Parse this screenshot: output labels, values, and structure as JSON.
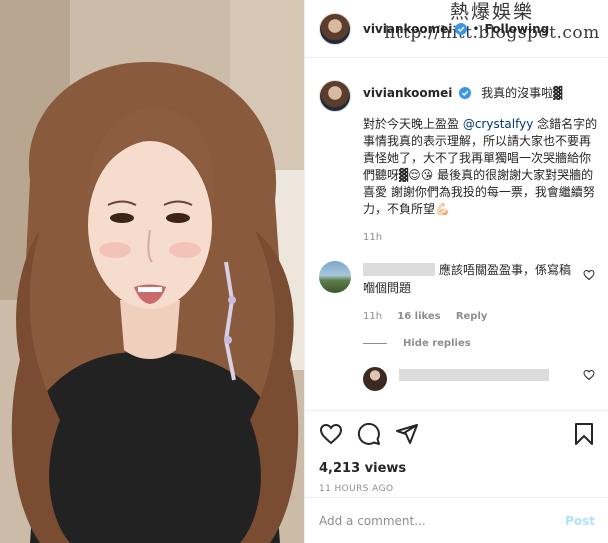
{
  "watermark": {
    "line1": "熱爆娛樂",
    "line2": "http://hitt.blogspot.com"
  },
  "header": {
    "username": "viviankoomei",
    "separator": "•",
    "follow_label": "Following"
  },
  "caption": {
    "username": "viviankoomei",
    "title": "我真的沒事啦▓",
    "text_before": "對於今天晚上盈盈 ",
    "mention": "@crystalfyy",
    "text_after": " 念錯名字的事情我真的表示理解，所以請大家也不要再責怪她了，大不了我再單獨唱一次哭牆給你們聽呀▓😌😘 最後真的很謝謝大家對哭牆的喜愛 謝謝你們為我投的每一票，我會繼續努力，不負所望💪🏻",
    "time": "11h"
  },
  "comment": {
    "text": "應該唔關盈盈事，係寫稿嗰個問題",
    "time": "11h",
    "likes": "16 likes",
    "reply_label": "Reply"
  },
  "hide_replies": "Hide replies",
  "stats": {
    "views": "4,213 views",
    "time_ago": "11 HOURS AGO"
  },
  "add_comment": {
    "placeholder": "Add a comment...",
    "post_label": "Post"
  },
  "colors": {
    "link": "#00376b",
    "verified": "#3897f0",
    "post_disabled": "#b2dffc",
    "muted": "#8e8e8e"
  },
  "icons": [
    "verified-badge-icon",
    "heart-icon",
    "comment-icon",
    "share-icon",
    "bookmark-icon"
  ]
}
